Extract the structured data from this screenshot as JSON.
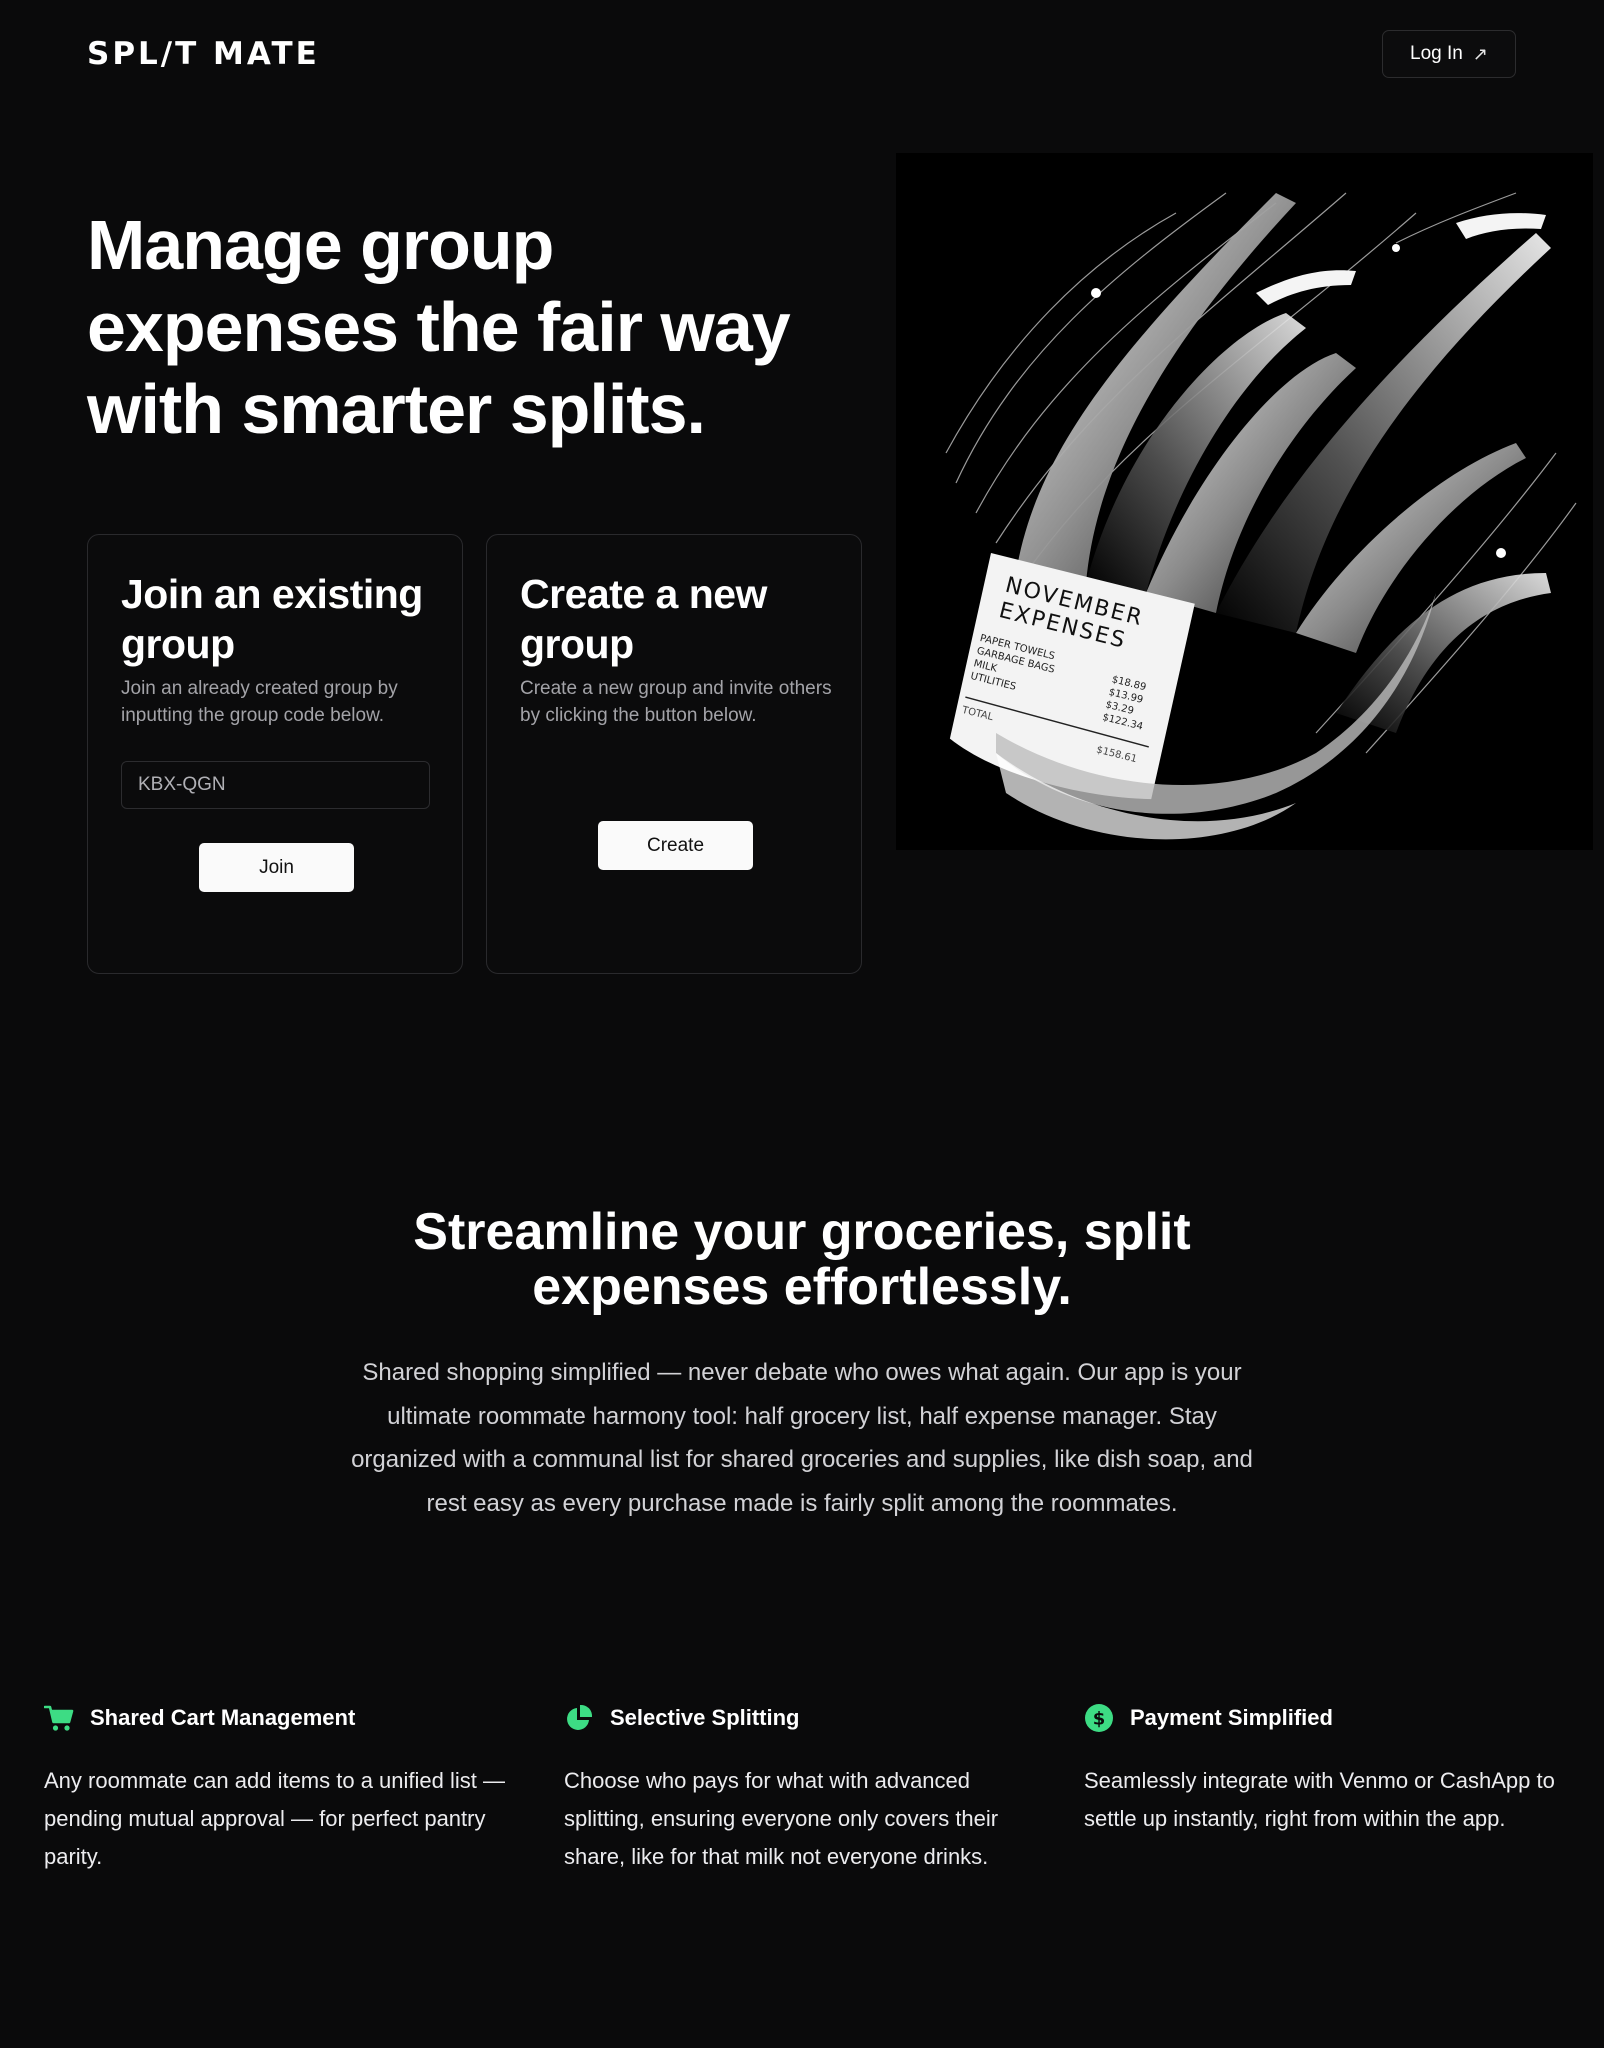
{
  "header": {
    "logo": "SPL/T MATE",
    "login_label": "Log In",
    "login_icon": "arrow-up-right-icon"
  },
  "hero": {
    "title": "Manage group expenses the fair way with smarter splits.",
    "join_card": {
      "title": "Join an existing group",
      "description": "Join an already created group by inputting the group code below.",
      "input_value": "KBX-QGN",
      "button_label": "Join"
    },
    "create_card": {
      "title": "Create a new group",
      "description": "Create a new group and invite others by clicking the button below.",
      "button_label": "Create"
    },
    "illustration": {
      "receipt_title_line1": "NOVEMBER",
      "receipt_title_line2": "EXPENSES",
      "items": [
        {
          "name": "PAPER TOWELS",
          "price": "$18.89"
        },
        {
          "name": "GARBAGE BAGS",
          "price": "$13.99"
        },
        {
          "name": "MILK",
          "price": "$3.29"
        },
        {
          "name": "UTILITIES",
          "price": "$122.34"
        }
      ],
      "total_label": "TOTAL",
      "total_value": "$158.61"
    }
  },
  "about": {
    "title": "Streamline your groceries, split expenses effortlessly.",
    "body": "Shared shopping simplified — never debate who owes what again. Our app is your ultimate roommate harmony tool: half grocery list, half expense manager. Stay organized with a communal list for shared groceries and supplies, like dish soap, and rest easy as every purchase made is fairly split among the roommates."
  },
  "features": [
    {
      "icon": "shopping-cart-icon",
      "title": "Shared Cart Management",
      "description": "Any roommate can add items to a unified list — pending mutual approval — for perfect pantry parity."
    },
    {
      "icon": "pie-chart-icon",
      "title": "Selective Splitting",
      "description": "Choose who pays for what with advanced splitting, ensuring everyone only covers their share, like for that milk not everyone drinks."
    },
    {
      "icon": "dollar-circle-icon",
      "title": "Payment Simplified",
      "description": "Seamlessly integrate with Venmo or CashApp to settle up instantly, right from within the app."
    }
  ],
  "colors": {
    "background": "#0a0a0b",
    "accent_green": "#3ddc84",
    "card_border": "#2a2a2d",
    "button_bg": "#fafafa"
  }
}
